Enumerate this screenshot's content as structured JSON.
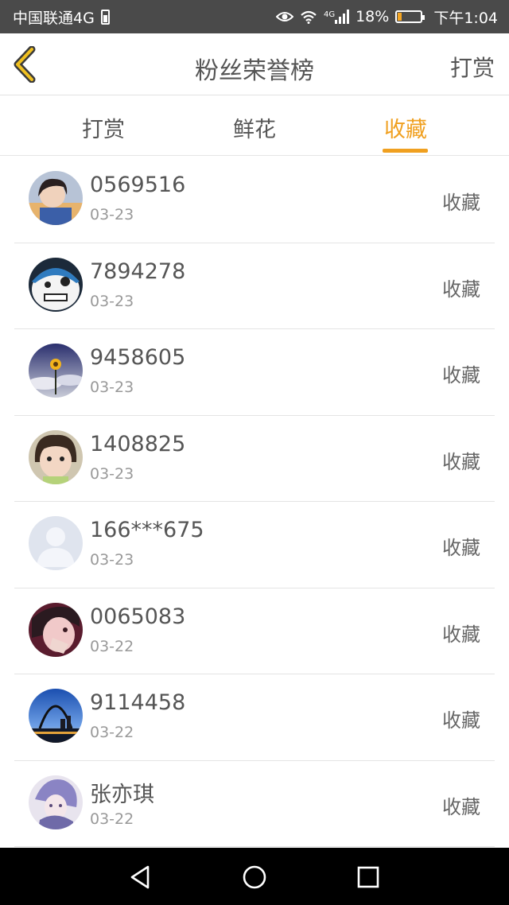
{
  "status_bar": {
    "carrier": "中国联通4G",
    "network_tag": "4G",
    "battery_percent": "18%",
    "time": "下午1:04",
    "battery_level": 0.18,
    "icons": [
      "sim-battery-icon",
      "eye-icon",
      "wifi-icon",
      "signal-icon",
      "battery-icon"
    ]
  },
  "header": {
    "title": "粉丝荣誉榜",
    "right_action": "打赏",
    "back_icon": "chevron-left-icon"
  },
  "tabs": {
    "items": [
      {
        "label": "打赏",
        "active": false
      },
      {
        "label": "鲜花",
        "active": false
      },
      {
        "label": "收藏",
        "active": true
      }
    ],
    "accent_color": "#f0a020"
  },
  "list": {
    "items": [
      {
        "name": "0569516",
        "date": "03-23",
        "action": "收藏",
        "avatar": "girl-photo"
      },
      {
        "name": "7894278",
        "date": "03-23",
        "action": "收藏",
        "avatar": "cartoon-face"
      },
      {
        "name": "9458605",
        "date": "03-23",
        "action": "收藏",
        "avatar": "sunflower-photo"
      },
      {
        "name": "1408825",
        "date": "03-23",
        "action": "收藏",
        "avatar": "child-photo"
      },
      {
        "name": "166***675",
        "date": "03-23",
        "action": "收藏",
        "avatar": "default-user"
      },
      {
        "name": "0065083",
        "date": "03-22",
        "action": "收藏",
        "avatar": "woman-photo"
      },
      {
        "name": "9114458",
        "date": "03-22",
        "action": "收藏",
        "avatar": "city-arch-photo"
      },
      {
        "name": "张亦琪",
        "date": "03-22",
        "action": "收藏",
        "avatar": "anime-photo"
      }
    ]
  },
  "system_nav": {
    "icons": [
      "back-triangle-icon",
      "home-circle-icon",
      "recents-square-icon"
    ]
  }
}
